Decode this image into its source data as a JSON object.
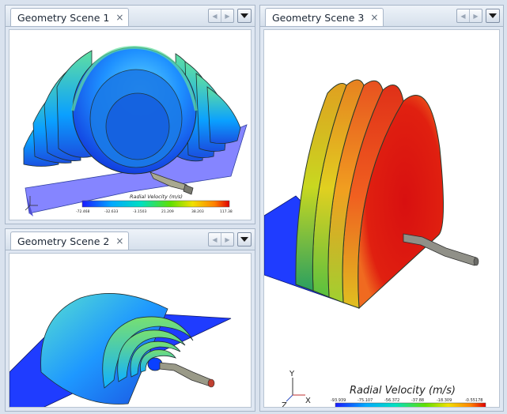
{
  "panels": {
    "scene1": {
      "tab_label": "Geometry Scene 1",
      "close_glyph": "×"
    },
    "scene2": {
      "tab_label": "Geometry Scene 2",
      "close_glyph": "×"
    },
    "scene3": {
      "tab_label": "Geometry Scene 3",
      "close_glyph": "×"
    }
  },
  "nav": {
    "prev_glyph": "◀",
    "next_glyph": "▶"
  },
  "legend_small": {
    "title": "Radial Velocity (m/s)",
    "ticks": [
      "-72.468",
      "-32.633",
      "-3.1503",
      "21.209",
      "38.203",
      "117.38"
    ]
  },
  "legend_large": {
    "title": "Radial Velocity (m/s)",
    "ticks": [
      "-93.939",
      "-75.107",
      "-56.372",
      "-37.88",
      "-18.309",
      "-0.55178"
    ]
  },
  "axes": {
    "y": "Y",
    "x": "X",
    "z": "Z"
  },
  "colors": {
    "scale": [
      "#1a1aff",
      "#00a8ff",
      "#00e0c0",
      "#60e000",
      "#f0e000",
      "#ff8000",
      "#e00000"
    ],
    "disc_edge": "#2a3a2a",
    "ground_plane": "#8080ff",
    "ground_plane_dark": "#1f3cff"
  }
}
